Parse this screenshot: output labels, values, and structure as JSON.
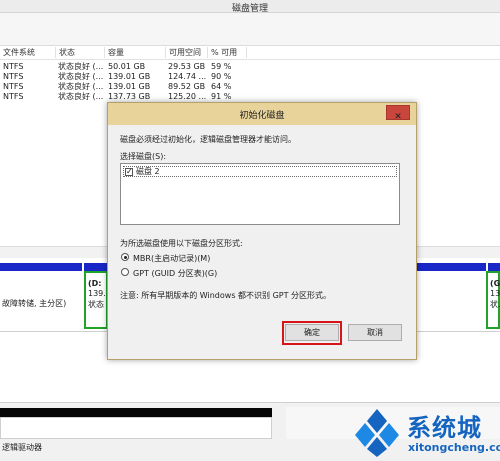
{
  "window": {
    "title": "磁盘管理"
  },
  "volume_table": {
    "columns": [
      "文件系统",
      "状态",
      "容量",
      "可用空间",
      "% 可用"
    ],
    "rows": [
      {
        "fs": "NTFS",
        "status": "状态良好 (...",
        "capacity": "50.01 GB",
        "free": "29.53 GB",
        "pct": "59 %"
      },
      {
        "fs": "NTFS",
        "status": "状态良好 (...",
        "capacity": "139.01 GB",
        "free": "124.74 ...",
        "pct": "90 %"
      },
      {
        "fs": "NTFS",
        "status": "状态良好 (...",
        "capacity": "139.01 GB",
        "free": "89.52 GB",
        "pct": "64 %"
      },
      {
        "fs": "NTFS",
        "status": "状态良好 (...",
        "capacity": "137.73 GB",
        "free": "125.20 ...",
        "pct": "91 %"
      }
    ]
  },
  "disk_map": {
    "partition_left_text": "故障转储, 主分区)",
    "partition_mid_name": "(D:",
    "partition_mid_size": "139.",
    "partition_mid_status": "状态",
    "partition_right_name": "(G",
    "partition_right_size": "139",
    "partition_right_status": "状..."
  },
  "bottom": {
    "label": "逻辑驱动器"
  },
  "dialog": {
    "title": "初始化磁盘",
    "close_glyph": "✕",
    "intro": "磁盘必须经过初始化，逻辑磁盘管理器才能访问。",
    "select_label": "选择磁盘(S):",
    "disks": [
      {
        "label": "磁盘 2",
        "checked": true,
        "check_glyph": "✓"
      }
    ],
    "style_label": "为所选磁盘使用以下磁盘分区形式:",
    "options": [
      {
        "label": "MBR(主启动记录)(M)",
        "selected": true
      },
      {
        "label": "GPT (GUID 分区表)(G)",
        "selected": false
      }
    ],
    "note": "注意: 所有早期版本的 Windows 都不识别 GPT 分区形式。",
    "ok_label": "确定",
    "cancel_label": "取消"
  },
  "watermark": {
    "brand": "系统城",
    "url": "xitongcheng.com"
  },
  "colors": {
    "partition_bar": "#1a27c8",
    "partition_border": "#1fa32a",
    "dialog_title": "#e8d39a",
    "close": "#c9463d",
    "highlight": "#d8141a",
    "watermark": "#1565c0"
  }
}
